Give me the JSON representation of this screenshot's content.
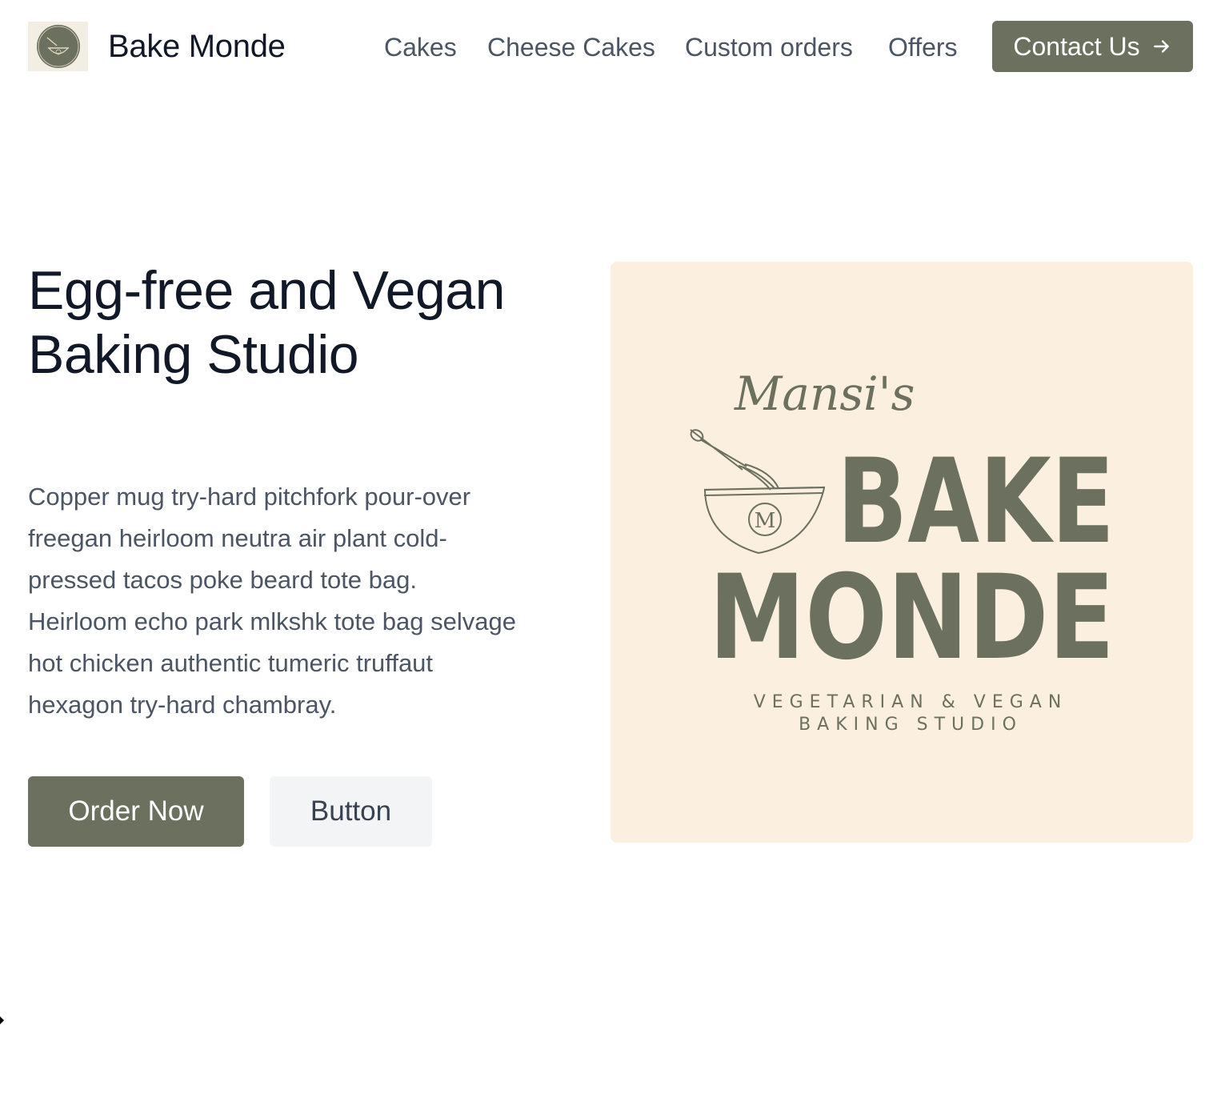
{
  "header": {
    "brand_name": "Bake Monde",
    "nav": [
      {
        "label": "Cakes"
      },
      {
        "label": "Cheese Cakes"
      },
      {
        "label": "Custom orders"
      },
      {
        "label": "Offers"
      }
    ],
    "contact_label": "Contact Us",
    "contact_icon": "arrow-right-icon"
  },
  "hero": {
    "title": "Egg-free and Vegan Baking Studio",
    "description": "Copper mug try-hard pitchfork pour-over freegan heirloom neutra air plant cold-pressed tacos poke beard tote bag. Heirloom echo park mlkshk tote bag selvage hot chicken authentic tumeric truffaut hexagon try-hard chambray.",
    "primary_button": "Order Now",
    "secondary_button": "Button"
  },
  "logo": {
    "script": "Mansi's",
    "line1": "BAKE",
    "line2": "MONDE",
    "tagline1": "VEGETARIAN & VEGAN",
    "tagline2": "BAKING STUDIO",
    "monogram": "M"
  },
  "colors": {
    "accent": "#6c705f",
    "cream": "#fbefe0",
    "heading": "#111827",
    "body_text": "#4b5563"
  }
}
